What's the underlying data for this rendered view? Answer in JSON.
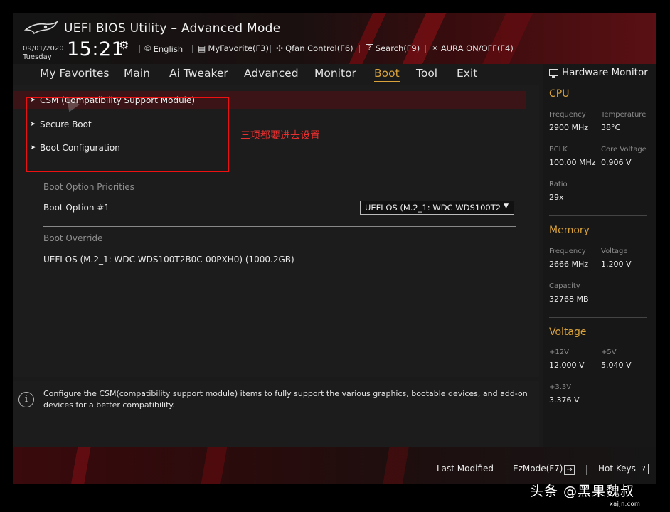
{
  "header": {
    "title": "UEFI BIOS Utility – Advanced Mode",
    "date": "09/01/2020",
    "day": "Tuesday",
    "time": "15:21",
    "toolbar": {
      "language": "English",
      "myfavorite": "MyFavorite(F3)",
      "qfan": "Qfan Control(F6)",
      "search": "Search(F9)",
      "aura": "AURA ON/OFF(F4)"
    }
  },
  "tabs": [
    "My Favorites",
    "Main",
    "Ai Tweaker",
    "Advanced",
    "Monitor",
    "Boot",
    "Tool",
    "Exit"
  ],
  "active_tab": "Boot",
  "menu": {
    "items": [
      "CSM (Compatibility Support Module)",
      "Secure Boot",
      "Boot Configuration"
    ],
    "annotation": "三项都要进去设置"
  },
  "boot_priorities": {
    "section_label": "Boot Option Priorities",
    "option1_label": "Boot Option #1",
    "option1_value": "UEFI OS (M.2_1: WDC WDS100T2"
  },
  "boot_override": {
    "section_label": "Boot Override",
    "item": "UEFI OS (M.2_1: WDC WDS100T2B0C-00PXH0) (1000.2GB)"
  },
  "help_text": "Configure the CSM(compatibility support module) items to fully support the various graphics, bootable devices, and add-on devices for a better compatibility.",
  "hardware_monitor": {
    "title": "Hardware Monitor",
    "cpu": {
      "heading": "CPU",
      "frequency_label": "Frequency",
      "frequency": "2900 MHz",
      "temperature_label": "Temperature",
      "temperature": "38°C",
      "bclk_label": "BCLK",
      "bclk": "100.00 MHz",
      "core_voltage_label": "Core Voltage",
      "core_voltage": "0.906 V",
      "ratio_label": "Ratio",
      "ratio": "29x"
    },
    "memory": {
      "heading": "Memory",
      "frequency_label": "Frequency",
      "frequency": "2666 MHz",
      "voltage_label": "Voltage",
      "voltage": "1.200 V",
      "capacity_label": "Capacity",
      "capacity": "32768 MB"
    },
    "voltage": {
      "heading": "Voltage",
      "v12_label": "+12V",
      "v12": "12.000 V",
      "v5_label": "+5V",
      "v5": "5.040 V",
      "v33_label": "+3.3V",
      "v33": "3.376 V"
    }
  },
  "footer": {
    "last_modified": "Last Modified",
    "ezmode": "EzMode(F7)",
    "hotkeys": "Hot Keys",
    "hotkeys_icon": "?"
  },
  "watermark": {
    "text": "头条 @黑果魏叔",
    "sub": "xajjn.com"
  },
  "colors": {
    "accent": "#d9a23a",
    "annotation_red": "#e11111",
    "selected_row": "#3a1416"
  }
}
